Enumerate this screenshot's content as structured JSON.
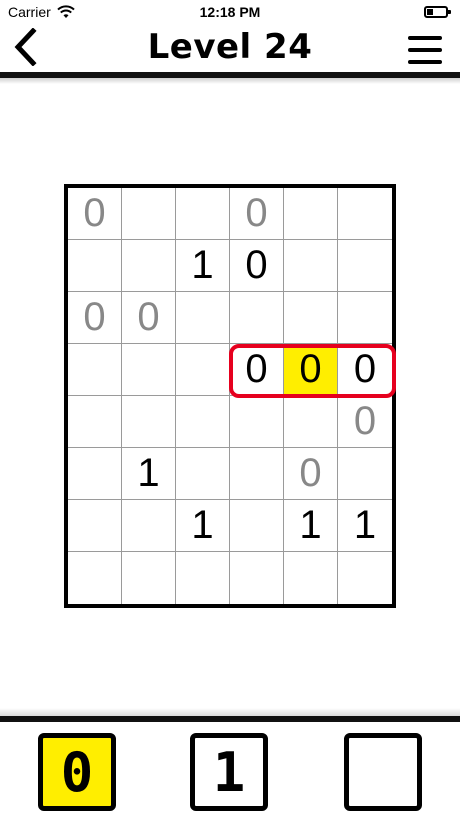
{
  "status_bar": {
    "carrier": "Carrier",
    "time": "12:18 PM"
  },
  "header": {
    "title": "Level 24",
    "back_icon": "chevron-left-icon",
    "menu_icon": "hamburger-menu-icon"
  },
  "colors": {
    "given_digit": "#888888",
    "user_digit": "#000000",
    "selected_cell": "#ffee00",
    "error_highlight": "#e6001e"
  },
  "board": {
    "rows": 8,
    "cols": 6,
    "cells": [
      [
        {
          "v": "0",
          "t": "given"
        },
        {
          "v": "",
          "t": ""
        },
        {
          "v": "",
          "t": ""
        },
        {
          "v": "0",
          "t": "given"
        },
        {
          "v": "",
          "t": ""
        },
        {
          "v": "",
          "t": ""
        }
      ],
      [
        {
          "v": "",
          "t": ""
        },
        {
          "v": "",
          "t": ""
        },
        {
          "v": "1",
          "t": "user"
        },
        {
          "v": "0",
          "t": "user"
        },
        {
          "v": "",
          "t": ""
        },
        {
          "v": "",
          "t": ""
        }
      ],
      [
        {
          "v": "0",
          "t": "given"
        },
        {
          "v": "0",
          "t": "given"
        },
        {
          "v": "",
          "t": ""
        },
        {
          "v": "",
          "t": ""
        },
        {
          "v": "",
          "t": ""
        },
        {
          "v": "",
          "t": ""
        }
      ],
      [
        {
          "v": "",
          "t": ""
        },
        {
          "v": "",
          "t": ""
        },
        {
          "v": "",
          "t": ""
        },
        {
          "v": "0",
          "t": "user"
        },
        {
          "v": "0",
          "t": "user",
          "selected": true
        },
        {
          "v": "0",
          "t": "user"
        }
      ],
      [
        {
          "v": "",
          "t": ""
        },
        {
          "v": "",
          "t": ""
        },
        {
          "v": "",
          "t": ""
        },
        {
          "v": "",
          "t": ""
        },
        {
          "v": "",
          "t": ""
        },
        {
          "v": "0",
          "t": "given"
        }
      ],
      [
        {
          "v": "",
          "t": ""
        },
        {
          "v": "1",
          "t": "user"
        },
        {
          "v": "",
          "t": ""
        },
        {
          "v": "",
          "t": ""
        },
        {
          "v": "0",
          "t": "given"
        },
        {
          "v": "",
          "t": ""
        }
      ],
      [
        {
          "v": "",
          "t": ""
        },
        {
          "v": "",
          "t": ""
        },
        {
          "v": "1",
          "t": "user"
        },
        {
          "v": "",
          "t": ""
        },
        {
          "v": "1",
          "t": "user"
        },
        {
          "v": "1",
          "t": "user"
        }
      ],
      [
        {
          "v": "",
          "t": ""
        },
        {
          "v": "",
          "t": ""
        },
        {
          "v": "",
          "t": ""
        },
        {
          "v": "",
          "t": ""
        },
        {
          "v": "",
          "t": ""
        },
        {
          "v": "",
          "t": ""
        }
      ]
    ]
  },
  "input_buttons": {
    "zero": "0",
    "one": "1",
    "clear": "",
    "active": "zero"
  }
}
